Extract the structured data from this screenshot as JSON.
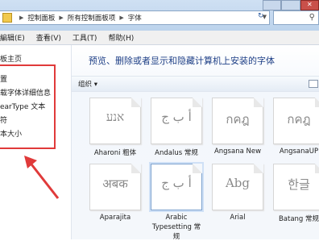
{
  "address": {
    "crumbs": [
      "控制面板",
      "所有控制面板项",
      "字体"
    ]
  },
  "search": {
    "icon": "search-icon"
  },
  "menu": [
    "編辑(E)",
    "查看(V)",
    "工具(T)",
    "帮助(H)"
  ],
  "sidebar": {
    "items": [
      "板主页",
      "置",
      "载字体详细信息",
      "earType 文本",
      "符",
      "本大小"
    ]
  },
  "heading": "预览、删除或者显示和隐藏计算机上安装的字体",
  "toolbar": {
    "organize": "组织 ▾"
  },
  "fonts": [
    {
      "sample": "אנע",
      "name": "Aharoni 粗体"
    },
    {
      "sample": "أ ب ج",
      "name": "Andalus 常规"
    },
    {
      "sample": "กคฎ",
      "name": "Angsana New"
    },
    {
      "sample": "กคฎ",
      "name": "AngsanaUP"
    },
    {
      "sample": "अबक",
      "name": "Aparajita"
    },
    {
      "sample": "أ ب ج",
      "name": "Arabic Typesetting 常规"
    },
    {
      "sample": "Abg",
      "name": "Arial"
    },
    {
      "sample": "한글",
      "name": "Batang 常规"
    }
  ],
  "colors": {
    "annotation": "#e03a3a",
    "heading": "#1e3f86"
  }
}
